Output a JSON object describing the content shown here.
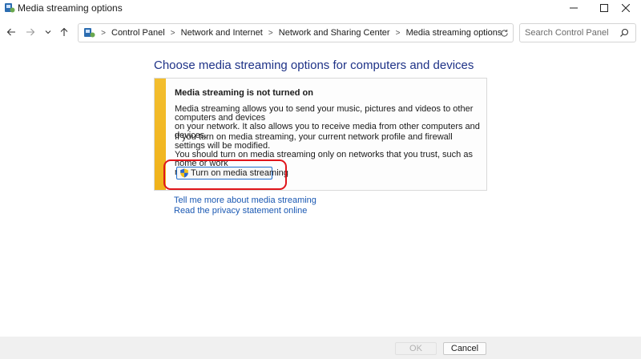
{
  "window": {
    "title": "Media streaming options",
    "icons": {
      "app": "media-streaming-icon",
      "minimize": "minimize-icon",
      "maximize": "maximize-icon",
      "close": "close-icon"
    }
  },
  "nav": {
    "icons": {
      "back": "back-arrow-icon",
      "forward": "forward-arrow-icon",
      "recent": "chevron-down-icon",
      "up": "up-arrow-icon",
      "refresh": "refresh-icon",
      "search": "search-icon"
    },
    "breadcrumbs": [
      "Control Panel",
      "Network and Internet",
      "Network and Sharing Center",
      "Media streaming options"
    ],
    "search_placeholder": "Search Control Panel"
  },
  "main": {
    "heading": "Choose media streaming options for computers and devices",
    "panel": {
      "accent_color": "#f0b21a",
      "title": "Media streaming is not turned on",
      "p1_line1": "Media streaming allows you to send your music, pictures and videos to other computers and devices",
      "p1_line2": "on your network.  It also allows you to receive media from other computers and devices.",
      "p2_line1": "If you turn on media streaming, your current network profile and firewall settings will be modified.",
      "p2_line2": "You should turn on media streaming only on networks that you trust, such as home or work",
      "p2_line3": "networks.",
      "button_label": "Turn on media streaming",
      "button_icon": "uac-shield-icon"
    },
    "highlight_color": "#e0151b",
    "links": [
      "Tell me more about media streaming",
      "Read the privacy statement online"
    ]
  },
  "footer": {
    "ok_label": "OK",
    "ok_enabled": false,
    "cancel_label": "Cancel"
  }
}
